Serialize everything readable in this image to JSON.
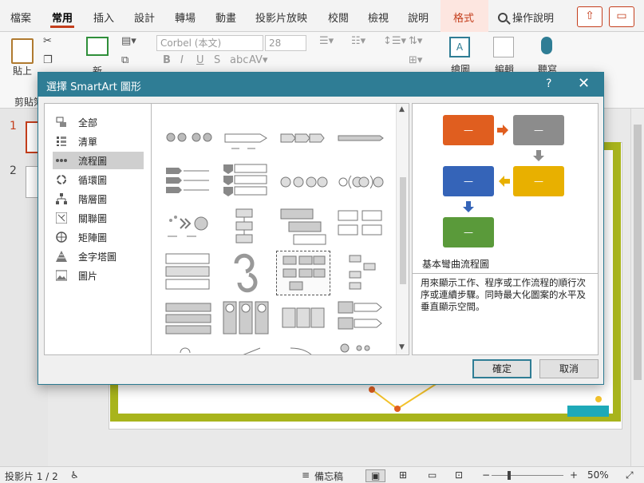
{
  "ribbon_tabs": [
    "檔案",
    "常用",
    "插入",
    "設計",
    "轉場",
    "動畫",
    "投影片放映",
    "校閱",
    "檢視",
    "說明",
    "格式"
  ],
  "active_tab": "常用",
  "tell_me": "操作說明",
  "ribbon": {
    "paste": "貼上",
    "clipboard": "剪貼簿",
    "new_slide": "新",
    "font_name": "Corbel (本文)",
    "font_size": "28",
    "draw": "繪圖",
    "edit": "編輯",
    "dictate": "聽寫"
  },
  "thumbnails": [
    "1",
    "2"
  ],
  "status": {
    "slide_count": "投影片 1 / 2",
    "notes": "備忘稿",
    "zoom": "50%"
  },
  "dialog": {
    "title": "選擇 SmartArt 圖形",
    "help": "?",
    "categories": [
      {
        "label": "全部",
        "icon": "all-icon"
      },
      {
        "label": "清單",
        "icon": "list-icon"
      },
      {
        "label": "流程圖",
        "icon": "process-icon"
      },
      {
        "label": "循環圖",
        "icon": "cycle-icon"
      },
      {
        "label": "階層圖",
        "icon": "hierarchy-icon"
      },
      {
        "label": "關聯圖",
        "icon": "relationship-icon"
      },
      {
        "label": "矩陣圖",
        "icon": "matrix-icon"
      },
      {
        "label": "金字塔圖",
        "icon": "pyramid-icon"
      },
      {
        "label": "圖片",
        "icon": "picture-icon"
      }
    ],
    "selected_category": "流程圖",
    "preview": {
      "name": "基本彎曲流程圖",
      "description": "用來顯示工作、程序或工作流程的順行次序或連續步驟。同時最大化圖案的水平及垂直顯示空間。",
      "box_label": "—",
      "colors": [
        "#e05e1f",
        "#8c8c8c",
        "#3564b8",
        "#e8b000",
        "#5a9a3a"
      ]
    },
    "ok": "確定",
    "cancel": "取消"
  }
}
